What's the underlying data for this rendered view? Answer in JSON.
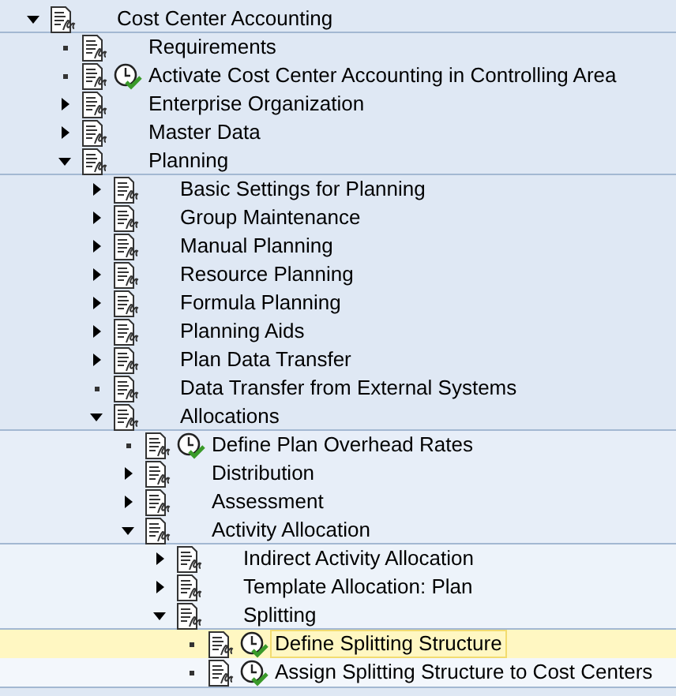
{
  "tree": [
    {
      "label": "Cost Center Accounting",
      "kind": "folder",
      "expanded": true,
      "executable": false,
      "selected": false,
      "children": [
        {
          "label": "Requirements",
          "kind": "leaf",
          "executable": false,
          "selected": false
        },
        {
          "label": "Activate Cost Center Accounting in Controlling Area",
          "kind": "leaf",
          "executable": true,
          "selected": false
        },
        {
          "label": "Enterprise Organization",
          "kind": "folder",
          "expanded": false,
          "executable": false,
          "selected": false
        },
        {
          "label": "Master Data",
          "kind": "folder",
          "expanded": false,
          "executable": false,
          "selected": false
        },
        {
          "label": "Planning",
          "kind": "folder",
          "expanded": true,
          "executable": false,
          "selected": false,
          "children": [
            {
              "label": "Basic Settings for Planning",
              "kind": "folder",
              "expanded": false,
              "executable": false,
              "selected": false
            },
            {
              "label": "Group Maintenance",
              "kind": "folder",
              "expanded": false,
              "executable": false,
              "selected": false
            },
            {
              "label": "Manual Planning",
              "kind": "folder",
              "expanded": false,
              "executable": false,
              "selected": false
            },
            {
              "label": "Resource Planning",
              "kind": "folder",
              "expanded": false,
              "executable": false,
              "selected": false
            },
            {
              "label": "Formula Planning",
              "kind": "folder",
              "expanded": false,
              "executable": false,
              "selected": false
            },
            {
              "label": "Planning Aids",
              "kind": "folder",
              "expanded": false,
              "executable": false,
              "selected": false
            },
            {
              "label": "Plan Data Transfer",
              "kind": "folder",
              "expanded": false,
              "executable": false,
              "selected": false
            },
            {
              "label": "Data Transfer from External Systems",
              "kind": "leaf",
              "executable": false,
              "selected": false
            },
            {
              "label": "Allocations",
              "kind": "folder",
              "expanded": true,
              "executable": false,
              "selected": false,
              "children": [
                {
                  "label": "Define Plan Overhead Rates",
                  "kind": "leaf",
                  "executable": true,
                  "selected": false
                },
                {
                  "label": "Distribution",
                  "kind": "folder",
                  "expanded": false,
                  "executable": false,
                  "selected": false
                },
                {
                  "label": "Assessment",
                  "kind": "folder",
                  "expanded": false,
                  "executable": false,
                  "selected": false
                },
                {
                  "label": "Activity Allocation",
                  "kind": "folder",
                  "expanded": true,
                  "executable": false,
                  "selected": false,
                  "children": [
                    {
                      "label": "Indirect Activity Allocation",
                      "kind": "folder",
                      "expanded": false,
                      "executable": false,
                      "selected": false
                    },
                    {
                      "label": "Template Allocation: Plan",
                      "kind": "folder",
                      "expanded": false,
                      "executable": false,
                      "selected": false
                    },
                    {
                      "label": "Splitting",
                      "kind": "folder",
                      "expanded": true,
                      "executable": false,
                      "selected": false,
                      "children": [
                        {
                          "label": "Define Splitting Structure",
                          "kind": "leaf",
                          "executable": true,
                          "selected": true
                        },
                        {
                          "label": "Assign Splitting Structure to Cost Centers",
                          "kind": "leaf",
                          "executable": true,
                          "selected": false
                        }
                      ]
                    }
                  ]
                }
              ]
            }
          ]
        }
      ]
    }
  ]
}
